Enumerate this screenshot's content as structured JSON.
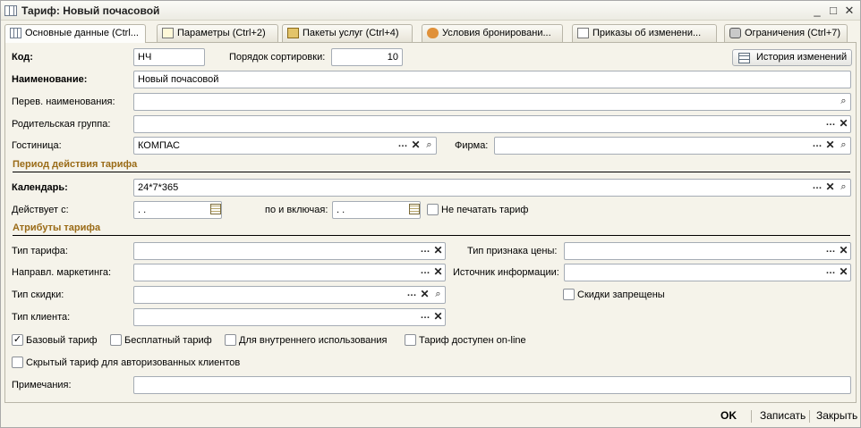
{
  "window": {
    "title": "Тариф: Новый почасовой",
    "controls": [
      "_",
      "□",
      "✕"
    ]
  },
  "tabs": [
    {
      "label": "Основные данные (Ctrl...",
      "icon": "form-icon"
    },
    {
      "label": "Параметры (Ctrl+2)",
      "icon": "notebook-icon"
    },
    {
      "label": "Пакеты услуг (Ctrl+4)",
      "icon": "package-icon"
    },
    {
      "label": "Условия бронировани...",
      "icon": "handshake-icon"
    },
    {
      "label": "Приказы об изменени...",
      "icon": "document-icon"
    },
    {
      "label": "Ограничения (Ctrl+7)",
      "icon": "lock-icon"
    }
  ],
  "main": {
    "code": {
      "label": "Код:",
      "value": "НЧ"
    },
    "sort_order": {
      "label": "Порядок сортировки:",
      "value": "10"
    },
    "history_button": "История изменений",
    "name": {
      "label": "Наименование:",
      "value": "Новый почасовой"
    },
    "translated_name": {
      "label": "Перев. наименования:",
      "value": ""
    },
    "parent_group": {
      "label": "Родительская группа:",
      "value": ""
    },
    "hotel": {
      "label": "Гостиница:",
      "value": "КОМПАС"
    },
    "firm": {
      "label": "Фирма:",
      "value": ""
    }
  },
  "period": {
    "heading": "Период действия тарифа",
    "calendar": {
      "label": "Календарь:",
      "value": "24*7*365"
    },
    "valid_from": {
      "label": "Действует с:",
      "value": " .  ."
    },
    "valid_to": {
      "label": "по и включая:",
      "value": " .  ."
    },
    "no_print": {
      "label": "Не печатать тариф",
      "checked": false
    }
  },
  "attributes": {
    "heading": "Атрибуты тарифа",
    "tariff_type": {
      "label": "Тип тарифа:",
      "value": ""
    },
    "price_sign_type": {
      "label": "Тип признака цены:",
      "value": ""
    },
    "marketing_direction": {
      "label": "Направл. маркетинга:",
      "value": ""
    },
    "info_source": {
      "label": "Источник информации:",
      "value": ""
    },
    "discount_type": {
      "label": "Тип скидки:",
      "value": ""
    },
    "discounts_forbidden": {
      "label": "Скидки запрещены",
      "checked": false
    },
    "client_type": {
      "label": "Тип клиента:",
      "value": ""
    },
    "base_tariff": {
      "label": "Базовый тариф",
      "checked": true
    },
    "free_tariff": {
      "label": "Бесплатный тариф",
      "checked": false
    },
    "internal_use": {
      "label": "Для внутреннего использования",
      "checked": false
    },
    "online_available": {
      "label": "Тариф доступен on-line",
      "checked": false
    },
    "hidden_tariff": {
      "label": "Скрытый тариф для авторизованных клиентов",
      "checked": false
    },
    "notes": {
      "label": "Примечания:",
      "value": ""
    }
  },
  "footer": {
    "ok": "OK",
    "save": "Записать",
    "close": "Закрыть"
  },
  "icons": {
    "select": "…",
    "clear": "✕",
    "search": "⌕",
    "checkmark": "✓"
  },
  "colors": {
    "section_heading": "#9a6b17",
    "window_bg": "#f5f3ea"
  }
}
